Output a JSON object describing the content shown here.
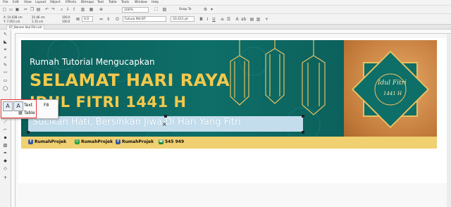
{
  "menu": [
    "File",
    "Edit",
    "View",
    "Layout",
    "Object",
    "Effects",
    "Bitmaps",
    "Text",
    "Table",
    "Tools",
    "Window",
    "Help"
  ],
  "toolbar": {
    "zoom_value": "100%",
    "snap_label": "Snap To"
  },
  "property_bar": {
    "x_label": "X: 14.038 cm",
    "y_label": "Y: 7.055 cm",
    "w_label": "25.46 cm",
    "h_label": "1.15 cm",
    "size_value": "100.0",
    "size_value2": "100.0",
    "angle_value": "0.0",
    "font_name": "Futura Md BT",
    "font_size": "33.411 pt"
  },
  "document": {
    "tab_label": "07_Banner Idul Fitri.cdr"
  },
  "banner": {
    "subtitle": "Rumah Tutorial Mengucapkan",
    "title_line1": "SELAMAT HARI RAYA",
    "title_line2": "IDUL FITRI 1441 H",
    "tagline": "Sucikan Hati, Bersihkan Jiwa Di Hari Yang Fitri",
    "emblem_line1": "Idul Fitri",
    "emblem_line2": "1441 H",
    "footer": [
      {
        "icon": "facebook-icon",
        "label": "RumahProjek",
        "color": "#3b5998"
      },
      {
        "icon": "whatsapp-icon",
        "label": "RumahProjek",
        "color": "#25a244"
      },
      {
        "icon": "facebook-icon",
        "label": "RumahProjek",
        "color": "#3b5998"
      },
      {
        "icon": "phone-icon",
        "label": "545 949",
        "color": "#1f8a3a"
      }
    ]
  },
  "flyout": {
    "items": [
      {
        "label": "Text",
        "shortcut": "F8"
      },
      {
        "label": "Table",
        "shortcut": ""
      }
    ]
  },
  "colors": {
    "banner_teal": "#0e6e68",
    "title_gold": "#f2c94c",
    "footer_yellow": "#f0d070",
    "emblem_orange": "#c07838",
    "selection_blue": "#cfe4f4"
  }
}
